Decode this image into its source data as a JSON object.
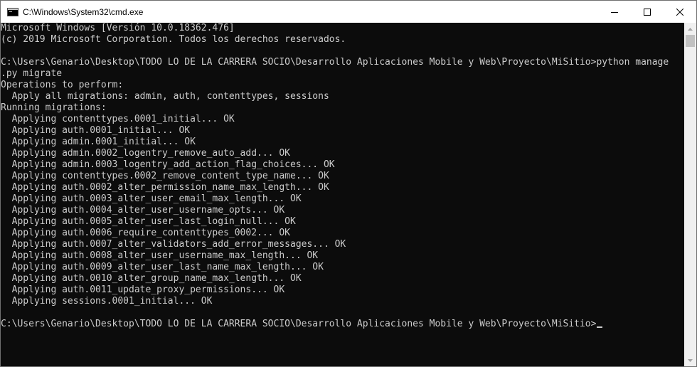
{
  "window": {
    "title": "C:\\Windows\\System32\\cmd.exe",
    "icon": "cmd-icon",
    "controls": [
      "minimize-icon",
      "maximize-icon",
      "close-icon"
    ]
  },
  "console": {
    "lines": [
      "Microsoft Windows [Versión 10.0.18362.476]",
      "(c) 2019 Microsoft Corporation. Todos los derechos reservados.",
      "",
      "C:\\Users\\Genario\\Desktop\\TODO LO DE LA CARRERA SOCIO\\Desarrollo Aplicaciones Mobile y Web\\Proyecto\\MiSitio>python manage",
      ".py migrate",
      "Operations to perform:",
      "  Apply all migrations: admin, auth, contenttypes, sessions",
      "Running migrations:",
      "  Applying contenttypes.0001_initial... OK",
      "  Applying auth.0001_initial... OK",
      "  Applying admin.0001_initial... OK",
      "  Applying admin.0002_logentry_remove_auto_add... OK",
      "  Applying admin.0003_logentry_add_action_flag_choices... OK",
      "  Applying contenttypes.0002_remove_content_type_name... OK",
      "  Applying auth.0002_alter_permission_name_max_length... OK",
      "  Applying auth.0003_alter_user_email_max_length... OK",
      "  Applying auth.0004_alter_user_username_opts... OK",
      "  Applying auth.0005_alter_user_last_login_null... OK",
      "  Applying auth.0006_require_contenttypes_0002... OK",
      "  Applying auth.0007_alter_validators_add_error_messages... OK",
      "  Applying auth.0008_alter_user_username_max_length... OK",
      "  Applying auth.0009_alter_user_last_name_max_length... OK",
      "  Applying auth.0010_alter_group_name_max_length... OK",
      "  Applying auth.0011_update_proxy_permissions... OK",
      "  Applying sessions.0001_initial... OK",
      ""
    ],
    "prompt": "C:\\Users\\Genario\\Desktop\\TODO LO DE LA CARRERA SOCIO\\Desarrollo Aplicaciones Mobile y Web\\Proyecto\\MiSitio>"
  },
  "colors": {
    "console_background": "#0c0c0c",
    "console_text": "#cccccc",
    "titlebar_background": "#ffffff"
  }
}
